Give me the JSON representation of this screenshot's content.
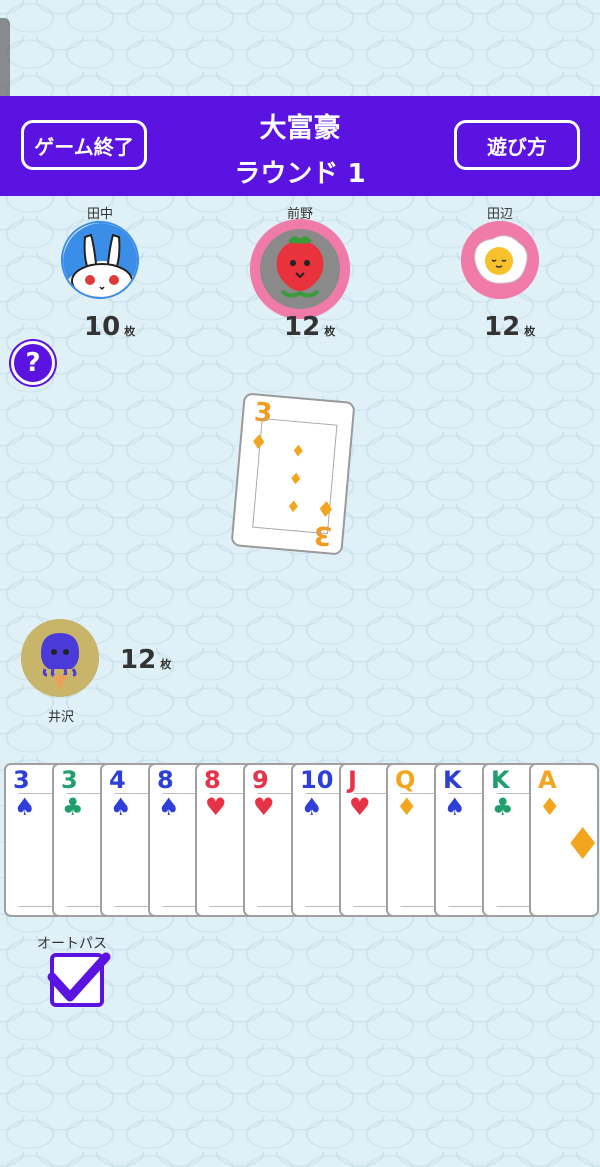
{
  "header": {
    "title": "大富豪",
    "round": "ラウンド 1",
    "end_game_label": "ゲーム終了",
    "how_to_play_label": "遊び方"
  },
  "opponents": [
    {
      "name": "田中",
      "count": "10",
      "unit": "枚",
      "avatar_icon": "rabbit-icon"
    },
    {
      "name": "前野",
      "count": "12",
      "unit": "枚",
      "avatar_icon": "strawberry-icon"
    },
    {
      "name": "田辺",
      "count": "12",
      "unit": "枚",
      "avatar_icon": "fried-egg-icon"
    }
  ],
  "help_label": "?",
  "played_card": {
    "rank": "3",
    "suit": "diamond"
  },
  "player": {
    "name": "井沢",
    "count": "12",
    "unit": "枚",
    "avatar_icon": "octopus-ice-cream-icon"
  },
  "hand": [
    {
      "rank": "3",
      "suit": "♠",
      "color": "#2d3fd6"
    },
    {
      "rank": "3",
      "suit": "♣",
      "color": "#1f9e6e"
    },
    {
      "rank": "4",
      "suit": "♠",
      "color": "#2d3fd6"
    },
    {
      "rank": "8",
      "suit": "♠",
      "color": "#2d3fd6"
    },
    {
      "rank": "8",
      "suit": "♥",
      "color": "#e63348"
    },
    {
      "rank": "9",
      "suit": "♥",
      "color": "#e63348"
    },
    {
      "rank": "10",
      "suit": "♠",
      "color": "#2d3fd6"
    },
    {
      "rank": "J",
      "suit": "♥",
      "color": "#e63348"
    },
    {
      "rank": "Q",
      "suit": "♦",
      "color": "#f3a51f"
    },
    {
      "rank": "K",
      "suit": "♠",
      "color": "#2d3fd6"
    },
    {
      "rank": "K",
      "suit": "♣",
      "color": "#1f9e6e"
    },
    {
      "rank": "A",
      "suit": "♦",
      "color": "#f3a51f"
    }
  ],
  "autopass": {
    "label": "オートパス",
    "checked": true
  },
  "colors": {
    "accent": "#5a13e0",
    "background": "#dff0f7"
  }
}
